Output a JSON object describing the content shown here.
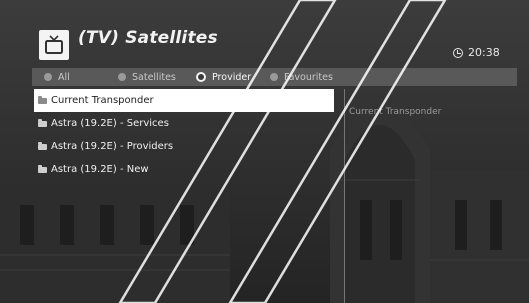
{
  "header": {
    "title": "(TV) Satellites",
    "tv_icon": "tv-icon",
    "clock_icon": "clock-icon",
    "time": "20:38"
  },
  "tabs": [
    {
      "label": "All",
      "selected": false
    },
    {
      "label": "Satellites",
      "selected": false
    },
    {
      "label": "Provider",
      "selected": true
    },
    {
      "label": "Favourites",
      "selected": false
    }
  ],
  "list": {
    "items": [
      {
        "label": "Current Transponder",
        "selected": true
      },
      {
        "label": "Astra (19.2E) - Services",
        "selected": false
      },
      {
        "label": "Astra (19.2E) - Providers",
        "selected": false
      },
      {
        "label": "Astra (19.2E) - New",
        "selected": false
      }
    ]
  },
  "detail": {
    "text": "Current Transponder"
  },
  "colors": {
    "background": "#2a2a2a",
    "tabbar": "#5f5f5f",
    "selection": "#ffffff"
  }
}
